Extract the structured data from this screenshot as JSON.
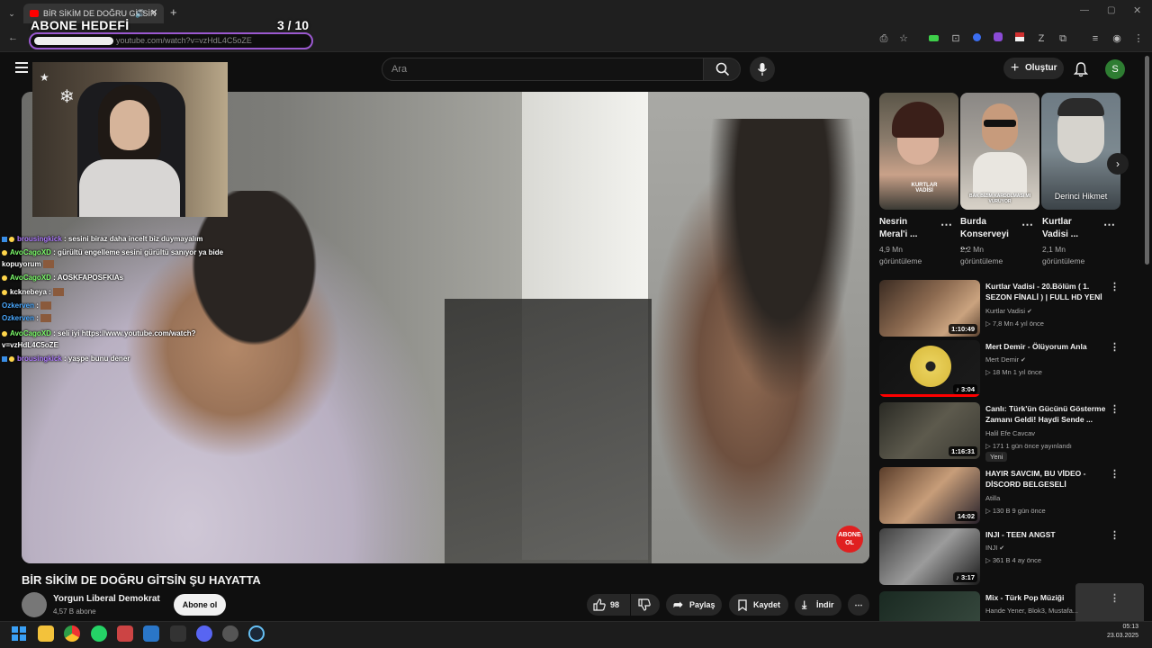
{
  "browser": {
    "tab_title": "BİR SİKİM DE DOĞRU GİTSİN",
    "url": "youtube.com/watch?v=vzHdL4C5oZE"
  },
  "overlay": {
    "goal_title": "ABONE HEDEFİ",
    "goal_count": "3  / 10"
  },
  "header": {
    "search_placeholder": "Ara",
    "create_label": "Oluştur",
    "avatar_letter": "S"
  },
  "chat": [
    {
      "badges": "sq-moon",
      "user": "brousingkick",
      "user_color": "purple",
      "text": ": sesini biraz daha incelt biz duymayalım"
    },
    {
      "badges": "moon",
      "user": "AvoCagoXD",
      "user_color": "green",
      "text": ": gürültü engelleme sesini gürültü sanıyor ya bide"
    },
    {
      "badges": "",
      "user": "",
      "user_color": "",
      "text": "kopuyorum"
    },
    {
      "badges": "moon",
      "user": "AvoCagoXD",
      "user_color": "green",
      "text": ": AOSKFAPOSFKIAs"
    },
    {
      "badges": "moon",
      "user": "kcknebeya",
      "user_color": "white",
      "text": ":"
    },
    {
      "badges": "",
      "user": "Ozkerven",
      "user_color": "blue",
      "text": ":"
    },
    {
      "badges": "",
      "user": "Ozkerven",
      "user_color": "blue",
      "text": ":"
    },
    {
      "badges": "moon",
      "user": "AvoCagoXD",
      "user_color": "green",
      "text": ": seli iyi https://www.youtube.com/watch?"
    },
    {
      "badges": "",
      "user": "",
      "user_color": "",
      "text": "v=vzHdL4C5oZE"
    },
    {
      "badges": "sq-moon",
      "user": "brousingkick",
      "user_color": "purple",
      "text": ": yaşpe bunu dener"
    }
  ],
  "video": {
    "title": "BİR SİKİM DE DOĞRU GİTSİN ŞU HAYATTA",
    "watermark": "ABONE OL",
    "channel_name": "Yorgun Liberal Demokrat",
    "subscribers": "4,57 B abone",
    "subscribe_label": "Abone ol",
    "likes": "98",
    "share_label": "Paylaş",
    "save_label": "Kaydet",
    "download_label": "İndir"
  },
  "shorts": [
    {
      "title": "Nesrin Meral'i ...",
      "views": "4,9 Mn görüntüleme",
      "thumb_text": "KURTLAR VADİSİ"
    },
    {
      "title": "Burda Konserveyi ...",
      "views": "2,2 Mn görüntüleme",
      "thumb_text": "BAK BİZİM KARDOLMASI MI VURUYOR"
    },
    {
      "title": "Kurtlar Vadisi ...",
      "views": "2,1 Mn görüntüleme",
      "thumb_text": "Derinci Hikmet"
    }
  ],
  "recommended": [
    {
      "title": "Kurtlar Vadisi - 20.Bölüm ( 1. SEZON FİNALİ ) | FULL HD YENİ",
      "channel": "Kurtlar Vadisi",
      "verified": true,
      "meta": "▷ 7,8 Mn   4 yıl önce",
      "duration": "1:10:49",
      "badge": ""
    },
    {
      "title": "Mert Demir - Ölüyorum Anla",
      "channel": "Mert Demir",
      "verified": true,
      "meta": "▷ 18 Mn   1 yıl önce",
      "duration": "♪ 3:04",
      "badge": ""
    },
    {
      "title": "Canlı: Türk'ün Gücünü Gösterme Zamanı Geldi! Haydi Sende ...",
      "channel": "Halil Efe Cavcav",
      "verified": false,
      "meta": "▷ 171   1 gün önce yayınlandı",
      "duration": "1:16:31",
      "badge": "Yeni"
    },
    {
      "title": "HAYIR SAVCIM, BU VİDEO - DİSCORD BELGESELİ",
      "channel": "Atilla",
      "verified": false,
      "meta": "▷ 130 B   9 gün önce",
      "duration": "14:02",
      "badge": ""
    },
    {
      "title": "INJI - TEEN ANGST",
      "channel": "INJI",
      "verified": true,
      "meta": "▷ 361 B   4 ay önce",
      "duration": "♪ 3:17",
      "badge": ""
    },
    {
      "title": "Mix - Türk Pop Müziği",
      "channel": "Hande Yener, Blok3, Mustafa...",
      "verified": false,
      "meta": "",
      "duration": "",
      "badge": ""
    }
  ],
  "taskbar": {
    "time": "05:13",
    "date": "23.03.2025"
  }
}
